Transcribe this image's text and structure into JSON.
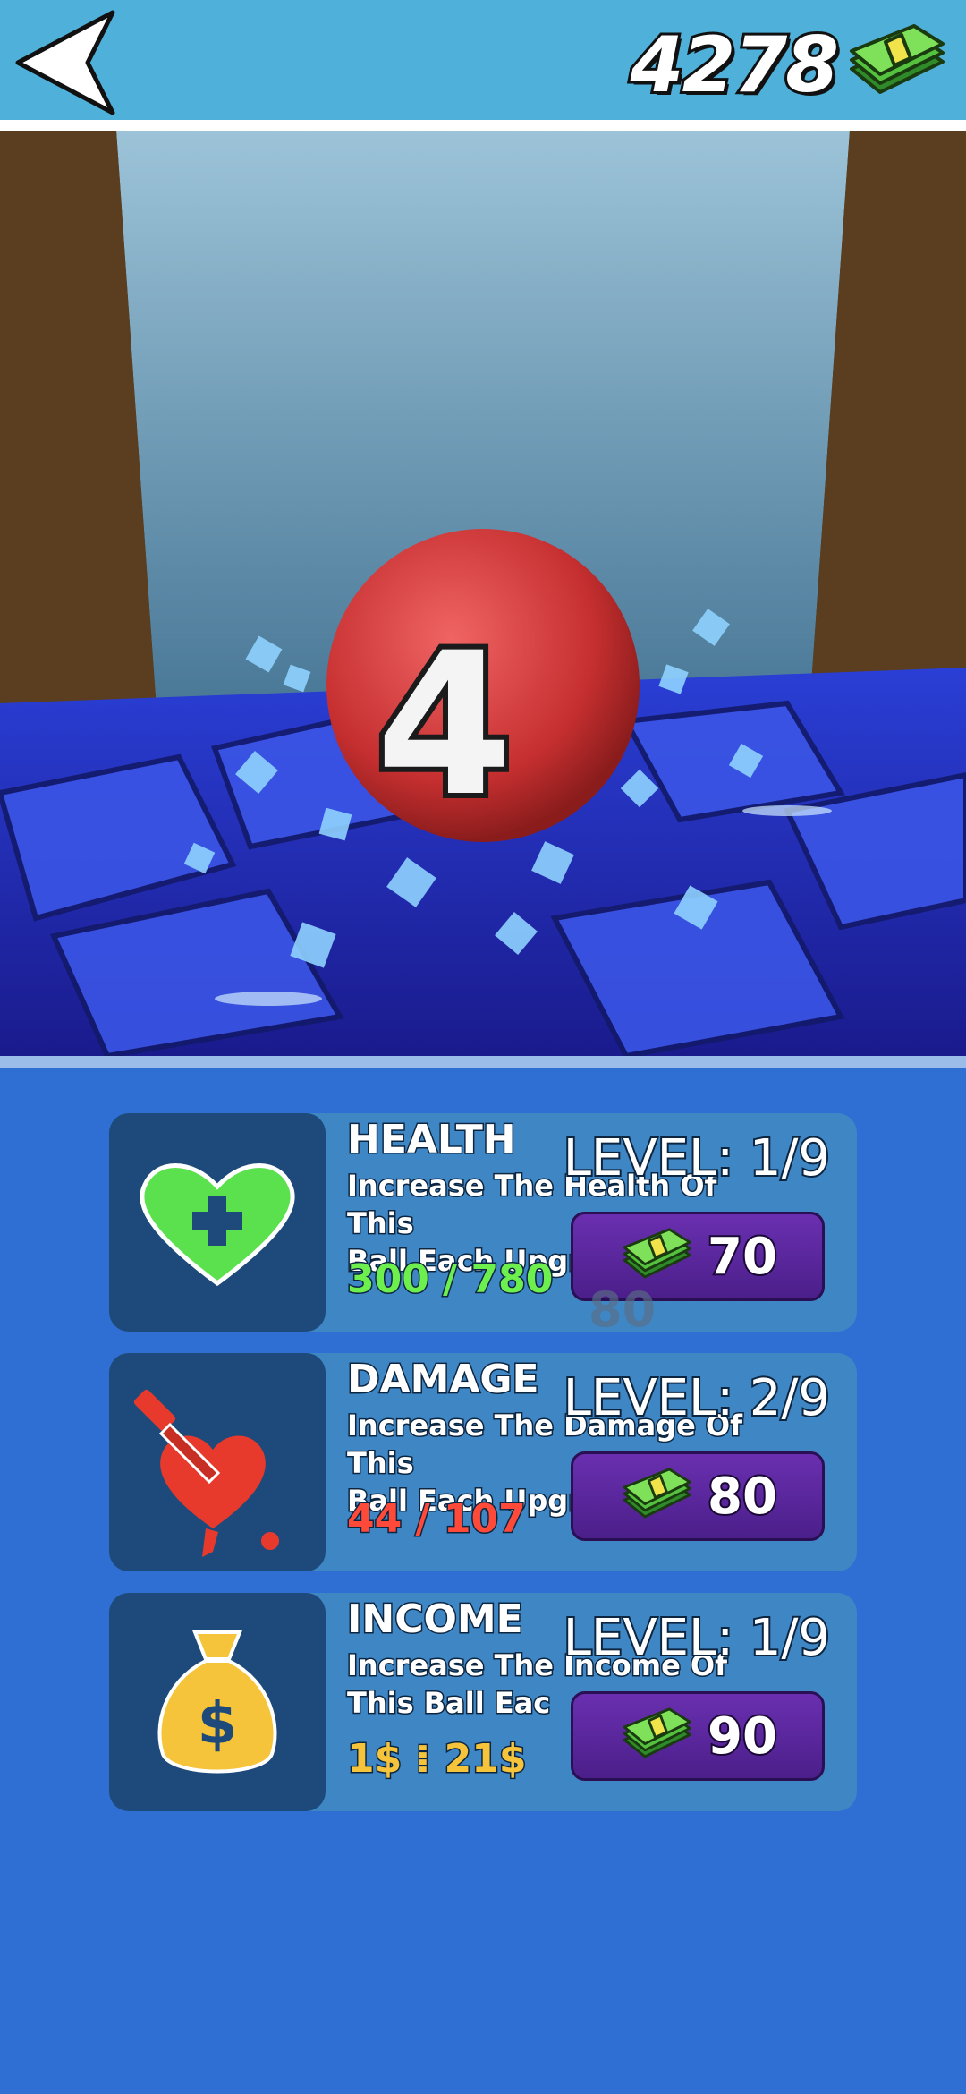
{
  "header": {
    "back_icon": "back-arrow-icon",
    "coins": "4278",
    "coins_icon": "cash-stack-icon"
  },
  "scene": {
    "ball_number": "4",
    "ball_color": "#d43b3b"
  },
  "upgrades": [
    {
      "id": "health",
      "icon": "heart-plus-icon",
      "title": "HEALTH",
      "description": "Increase The Health Of This\nBall Each Upgra",
      "stat": "300 / 780",
      "stat_color": "#6df04e",
      "level": "LEVEL: 1/9",
      "price": "70"
    },
    {
      "id": "damage",
      "icon": "bleeding-heart-dagger-icon",
      "title": "DAMAGE",
      "description": "Increase The Damage Of This\nBall Each Upgra",
      "stat": "44 / 107",
      "stat_color": "#ff4a3a",
      "level": "LEVEL: 2/9",
      "price": "80"
    },
    {
      "id": "income",
      "icon": "money-bag-icon",
      "title": "INCOME",
      "description": "Increase The Income Of\nThis Ball Eac",
      "stat": "1$ ⁞ 21$",
      "stat_color": "#f6c43a",
      "level": "LEVEL: 1/9",
      "price": "90"
    }
  ],
  "ghost_price": "80",
  "colors": {
    "topbar": "#4fb0da",
    "panel_bg": "#2f6fd4",
    "card_bg": "#3f86c4",
    "icon_box": "#1d4a7a",
    "button": "#5b27a0"
  }
}
